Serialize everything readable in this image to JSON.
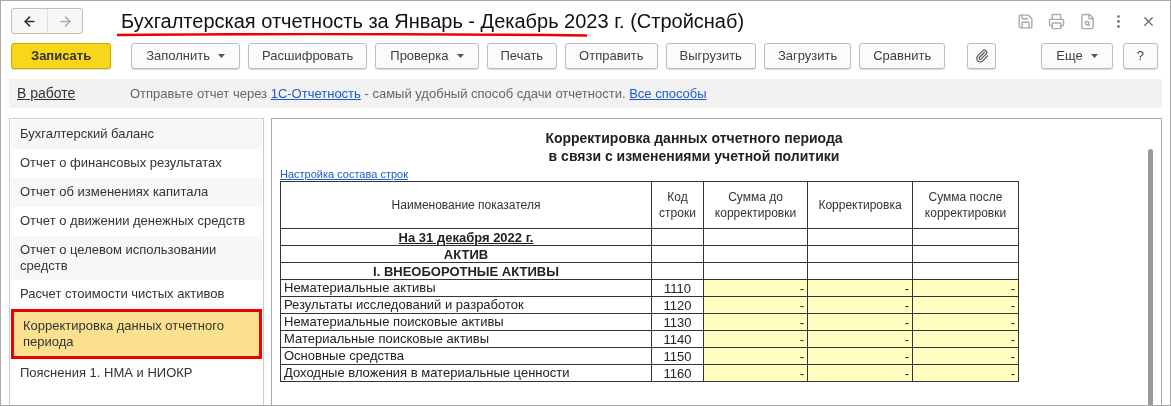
{
  "window": {
    "title": "Бухгалтерская отчетность за Январь - Декабрь 2023 г. (Стройснаб)"
  },
  "nav": [
    {
      "kind": "back",
      "disabled": false
    },
    {
      "kind": "forward",
      "disabled": true
    }
  ],
  "toolbar": [
    {
      "kind": "primary",
      "label": "Записать"
    },
    {
      "kind": "dropdown",
      "label": "Заполнить"
    },
    {
      "kind": "plain",
      "label": "Расшифровать"
    },
    {
      "kind": "dropdown",
      "label": "Проверка"
    },
    {
      "kind": "plain",
      "label": "Печать"
    },
    {
      "kind": "plain",
      "label": "Отправить"
    },
    {
      "kind": "plain",
      "label": "Выгрузить"
    },
    {
      "kind": "plain",
      "label": "Загрузить"
    },
    {
      "kind": "plain",
      "label": "Сравнить"
    },
    {
      "kind": "attach"
    }
  ],
  "toolbar_right": [
    {
      "kind": "dropdown",
      "label": "Еще"
    },
    {
      "kind": "plain",
      "label": "?"
    }
  ],
  "info_bar": {
    "status": "В работе",
    "message": [
      {
        "kind": "text",
        "text": "Отправьте отчет через "
      },
      {
        "kind": "link",
        "text": "1С-Отчетность"
      },
      {
        "kind": "text",
        "text": " - самый удобный способ сдачи отчетности. "
      },
      {
        "kind": "link",
        "text": "Все способы"
      }
    ]
  },
  "sidebar": {
    "items": [
      {
        "label": "Бухгалтерский баланс",
        "selected": false
      },
      {
        "label": "Отчет о финансовых результатах",
        "selected": false
      },
      {
        "label": "Отчет об изменениях капитала",
        "selected": false
      },
      {
        "label": "Отчет о движении денежных средств",
        "selected": false
      },
      {
        "label": "Отчет о целевом использовании средств",
        "selected": false
      },
      {
        "label": "Расчет стоимости чистых активов",
        "selected": false
      },
      {
        "label": "Корректировка данных отчетного периода",
        "selected": true
      },
      {
        "label": "Пояснения 1. НМА и НИОКР",
        "selected": false
      }
    ]
  },
  "report": {
    "title": [
      "Корректировка данных отчетного периода",
      "в связи с изменениями учетной политики"
    ],
    "settings_link": "Настройка состава строк",
    "table": {
      "columns": [
        "Наименование показателя",
        "Код строки",
        "Сумма до корректировки",
        "Корректировка",
        "Сумма после корректировки"
      ],
      "rows": [
        {
          "kind": "date",
          "name": "На 31 декабря 2022 г."
        },
        {
          "kind": "section",
          "name": "АКТИВ"
        },
        {
          "kind": "section",
          "name": "I. ВНЕОБОРОТНЫЕ АКТИВЫ"
        },
        {
          "kind": "data",
          "name": "Нематериальные активы",
          "code": "1110",
          "values": [
            "-",
            "-",
            "-"
          ]
        },
        {
          "kind": "data",
          "name": "Результаты исследований и разработок",
          "code": "1120",
          "values": [
            "-",
            "-",
            "-"
          ]
        },
        {
          "kind": "data",
          "name": "Нематериальные поисковые активы",
          "code": "1130",
          "values": [
            "-",
            "-",
            "-"
          ]
        },
        {
          "kind": "data",
          "name": "Материальные поисковые активы",
          "code": "1140",
          "values": [
            "-",
            "-",
            "-"
          ]
        },
        {
          "kind": "data",
          "name": "Основные средства",
          "code": "1150",
          "values": [
            "-",
            "-",
            "-"
          ]
        },
        {
          "kind": "data",
          "name": "Доходные вложения в материальные ценности",
          "code": "1160",
          "values": [
            "-",
            "-",
            "-"
          ]
        }
      ]
    }
  }
}
